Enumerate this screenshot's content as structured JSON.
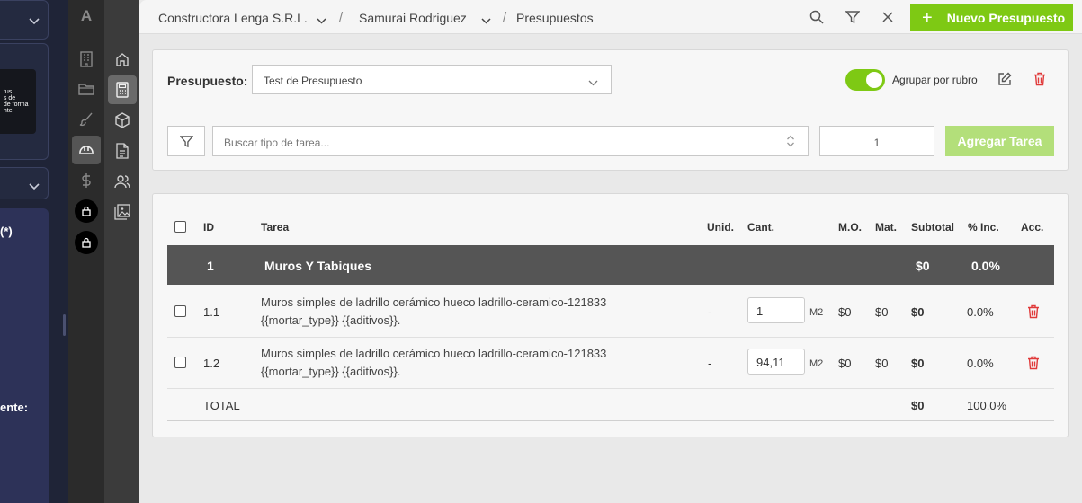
{
  "background": {
    "thumb_text": "  tus\n  s de\n  de forma\n  nte",
    "card_lines": [
      "(*)",
      "ente:"
    ]
  },
  "rail1": {
    "logo": "A",
    "icons": [
      "building-icon",
      "folder-icon",
      "brush-icon",
      "helmet-icon",
      "dollar-icon",
      "lock-icon",
      "lock-icon"
    ]
  },
  "rail2": {
    "icons": [
      "home-icon",
      "calculator-icon",
      "cube-icon",
      "document-icon",
      "users-icon",
      "gallery-icon"
    ]
  },
  "topbar": {
    "company": "Constructora Lenga S.R.L.",
    "sep1": "/",
    "client": "Samurai Rodriguez",
    "sep2": "/",
    "section": "Presupuestos",
    "new_button": "Nuevo Presupuesto",
    "new_button_icon": "+"
  },
  "form": {
    "budget_label": "Presupuesto:",
    "budget_value": "Test de Presupuesto",
    "group_toggle_label": "Agrupar por rubro",
    "group_toggle_on": true,
    "task_placeholder": "Buscar tipo de tarea...",
    "quantity_value": "1",
    "add_button": "Agregar Tarea"
  },
  "table": {
    "headers": {
      "id": "ID",
      "tarea": "Tarea",
      "unid": "Unid.",
      "cant": "Cant.",
      "mo": "M.O.",
      "mat": "Mat.",
      "subtotal": "Subtotal",
      "inc": "% Inc.",
      "acc": "Acc."
    },
    "group": {
      "id": "1",
      "name": "Muros Y Tabiques",
      "subtotal": "$0",
      "inc": "0.0%"
    },
    "rows": [
      {
        "id": "1.1",
        "desc_line1": "Muros simples de ladrillo cerámico hueco ladrillo-ceramico-121833",
        "desc_line2": "{{mortar_type}} {{aditivos}}.",
        "unid": "-",
        "cant": "1",
        "unit": "M2",
        "mo": "$0",
        "mat": "$0",
        "subtotal": "$0",
        "inc": "0.0%"
      },
      {
        "id": "1.2",
        "desc_line1": "Muros simples de ladrillo cerámico hueco ladrillo-ceramico-121833",
        "desc_line2": "{{mortar_type}} {{aditivos}}.",
        "unid": "-",
        "cant": "94,11",
        "unit": "M2",
        "mo": "$0",
        "mat": "$0",
        "subtotal": "$0",
        "inc": "0.0%"
      }
    ],
    "total": {
      "label": "TOTAL",
      "subtotal": "$0",
      "inc": "100.0%"
    }
  },
  "colors": {
    "accent": "#7ec914",
    "accent_disabled": "#b3df7a",
    "danger": "#e03a3a",
    "group_row": "#555555"
  }
}
